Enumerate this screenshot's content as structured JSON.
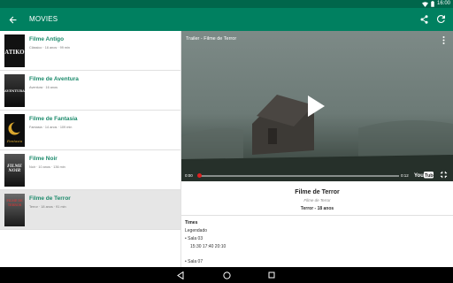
{
  "status_bar": {
    "time": "16:00",
    "icons": [
      "wifi-icon",
      "battery-icon"
    ],
    "color": "#00664b"
  },
  "app_bar": {
    "title": "MOVIES",
    "color": "#008060",
    "icons": [
      "back-arrow-icon",
      "share-icon",
      "refresh-icon"
    ]
  },
  "movies": [
    {
      "title": "Filme Antigo",
      "meta": "Clássico · 16 anos · 99 min",
      "poster_text": "ATIKO",
      "selected": false
    },
    {
      "title": "Filme de Aventura",
      "meta": "Aventura · 16 anos",
      "poster_text": "AVENTURA",
      "selected": false
    },
    {
      "title": "Filme de Fantasia",
      "meta": "Fantasia · 14 anos · 109 min",
      "poster_text": "Fantasia",
      "selected": false
    },
    {
      "title": "Filme Noir",
      "meta": "Noir · 10 anos · 136 min",
      "poster_text": "FILME NOIR",
      "selected": false
    },
    {
      "title": "Filme de Terror",
      "meta": "Terror · 18 anos · 91 min",
      "poster_text": "FILME DE TERROR",
      "selected": true
    }
  ],
  "player": {
    "video_title": "Trailer - Filme de Terror",
    "time_current": "0:00",
    "time_total": "0:12",
    "progress": 0.0,
    "logo": "YouTube",
    "accent": "#e02020"
  },
  "details": {
    "title": "Filme de Terror",
    "original_title": "Filme de Terror",
    "info": "Terror - 18 anos",
    "times_label": "Times",
    "subtitle_label": "Legendado",
    "rooms": [
      {
        "name": "• Sala 03",
        "times": "15:30 17:40 20:10"
      },
      {
        "name": "• Sala 07",
        "times": ""
      }
    ]
  },
  "nav_bar": {
    "icons": [
      "back-triangle-icon",
      "home-circle-icon",
      "recents-square-icon"
    ]
  }
}
